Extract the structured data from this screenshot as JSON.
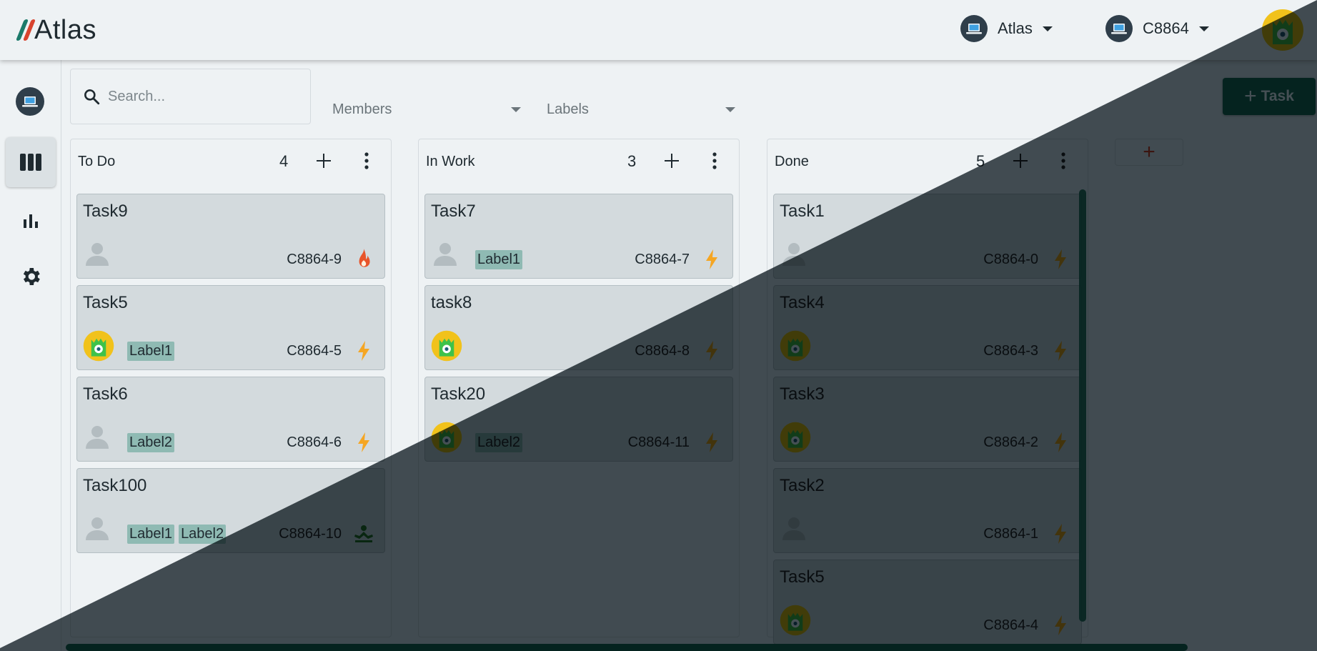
{
  "app": {
    "name": "Atlas"
  },
  "header": {
    "workspace_selector": "Atlas",
    "project_selector": "C8864"
  },
  "toolbar": {
    "search_placeholder": "Search...",
    "members_filter": "Members",
    "labels_filter": "Labels",
    "add_task_label": "Task",
    "add_column_symbol": "+"
  },
  "colors": {
    "accent": "#12715e",
    "label_bg": "#8fbab3",
    "fire": "#e8542a",
    "bolt": "#f5a623",
    "low": "#1e7a32"
  },
  "columns": [
    {
      "title": "To Do",
      "count": "4",
      "cards": [
        {
          "title": "Task9",
          "id": "C8864-9",
          "avatar": "default-user-icon",
          "labels": [],
          "priority": "fire-icon"
        },
        {
          "title": "Task5",
          "id": "C8864-5",
          "avatar": "user-avatar",
          "labels": [
            "Label1"
          ],
          "priority": "bolt-icon"
        },
        {
          "title": "Task6",
          "id": "C8864-6",
          "avatar": "default-user-icon",
          "labels": [
            "Label2"
          ],
          "priority": "bolt-icon"
        },
        {
          "title": "Task100",
          "id": "C8864-10",
          "avatar": "default-user-icon",
          "labels": [
            "Label1",
            "Label2"
          ],
          "priority": "meditation-icon"
        }
      ]
    },
    {
      "title": "In Work",
      "count": "3",
      "cards": [
        {
          "title": "Task7",
          "id": "C8864-7",
          "avatar": "default-user-icon",
          "labels": [
            "Label1"
          ],
          "priority": "bolt-icon"
        },
        {
          "title": "task8",
          "id": "C8864-8",
          "avatar": "user-avatar",
          "labels": [],
          "priority": "bolt-icon"
        },
        {
          "title": "Task20",
          "id": "C8864-11",
          "avatar": "user-avatar",
          "labels": [
            "Label2"
          ],
          "priority": "bolt-icon"
        }
      ]
    },
    {
      "title": "Done",
      "count": "5",
      "cards": [
        {
          "title": "Task1",
          "id": "C8864-0",
          "avatar": "default-user-icon",
          "labels": [],
          "priority": "bolt-icon"
        },
        {
          "title": "Task4",
          "id": "C8864-3",
          "avatar": "user-avatar",
          "labels": [],
          "priority": "bolt-icon"
        },
        {
          "title": "Task3",
          "id": "C8864-2",
          "avatar": "user-avatar",
          "labels": [],
          "priority": "bolt-icon"
        },
        {
          "title": "Task2",
          "id": "C8864-1",
          "avatar": "default-user-icon",
          "labels": [],
          "priority": "bolt-icon"
        },
        {
          "title": "Task5",
          "id": "C8864-4",
          "avatar": "user-avatar",
          "labels": [],
          "priority": "bolt-icon"
        }
      ]
    }
  ]
}
